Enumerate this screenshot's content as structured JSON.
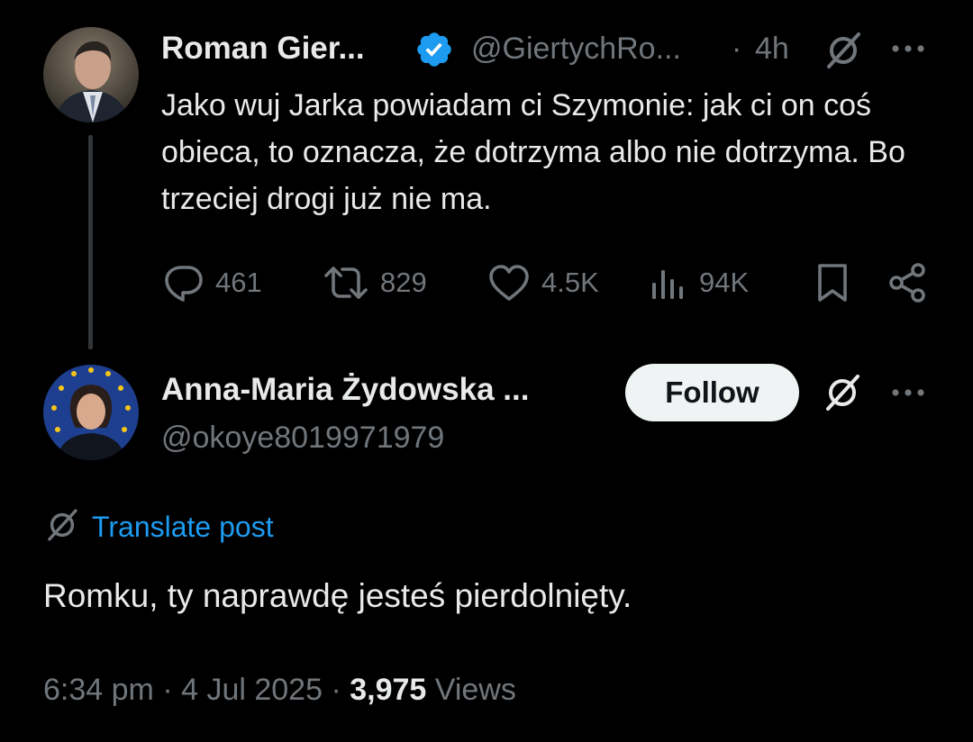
{
  "parent_post": {
    "author_name": "Roman Gier...",
    "handle": "@GiertychRo...",
    "separator": "·",
    "time_ago": "4h",
    "text": "Jako wuj Jarka powiadam ci Szymonie: jak ci on coś obieca, to oznacza, że dotrzyma albo nie dotrzyma. Bo trzeciej drogi już nie ma.",
    "metrics": {
      "replies": "461",
      "reposts": "829",
      "likes": "4.5K",
      "views": "94K"
    },
    "verified_color": "#1d9bf0"
  },
  "reply_post": {
    "author_name": "Anna-Maria Żydowska ...",
    "handle": "@okoye8019971979",
    "follow_label": "Follow",
    "translate_label": "Translate post",
    "text": "Romku, ty naprawdę jesteś pierdolnięty.",
    "footer": {
      "time": "6:34 pm",
      "sep1": "·",
      "date": "4 Jul 2025",
      "sep2": "·",
      "views_count": "3,975",
      "views_label": "Views"
    }
  },
  "colors": {
    "background": "#000000",
    "text_primary": "#e7e9ea",
    "text_secondary": "#71767b",
    "accent": "#1d9bf0",
    "follow_bg": "#eff3f4"
  },
  "icons": [
    "verified-badge-icon",
    "grok-icon",
    "more-icon",
    "reply-icon",
    "repost-icon",
    "like-icon",
    "views-icon",
    "bookmark-icon",
    "share-icon",
    "translate-icon"
  ]
}
